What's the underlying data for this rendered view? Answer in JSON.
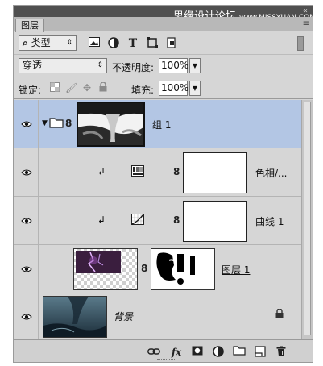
{
  "watermark": {
    "text": "思缘设计论坛",
    "url": "www.MISSYUAN.COM"
  },
  "title_icons": {
    "collapse": "«",
    "close": "x"
  },
  "tab": {
    "label": "图层",
    "menu_icon": "panel-menu-icon"
  },
  "filter": {
    "kind_label": "类型",
    "icons": [
      "image-filter-icon",
      "adjustment-filter-icon",
      "type-filter-icon",
      "shape-filter-icon",
      "smart-object-filter-icon"
    ]
  },
  "blend": {
    "mode": "穿透",
    "opacity_label": "不透明度:",
    "opacity_value": "100%"
  },
  "lock": {
    "label": "锁定:",
    "fill_label": "填充:",
    "fill_value": "100%"
  },
  "layers": [
    {
      "name": "组 1",
      "type": "group",
      "selected": true
    },
    {
      "name": "色相/...",
      "type": "adjustment-hue",
      "clipped": true
    },
    {
      "name": "曲线 1",
      "type": "adjustment-curves",
      "clipped": true
    },
    {
      "name": "图层 1",
      "type": "pixel-with-mask"
    },
    {
      "name": "背景",
      "type": "background",
      "locked": true
    }
  ],
  "bottom_icons": [
    "link-layers-icon",
    "fx-icon",
    "add-mask-icon",
    "new-adjustment-icon",
    "new-group-icon",
    "new-layer-icon",
    "delete-icon"
  ],
  "bottom_labels": {
    "fx": "fx"
  },
  "colors": {
    "panel": "#d6d6d6",
    "selected_row": "#b3c6e4",
    "titlebar": "#505050"
  }
}
